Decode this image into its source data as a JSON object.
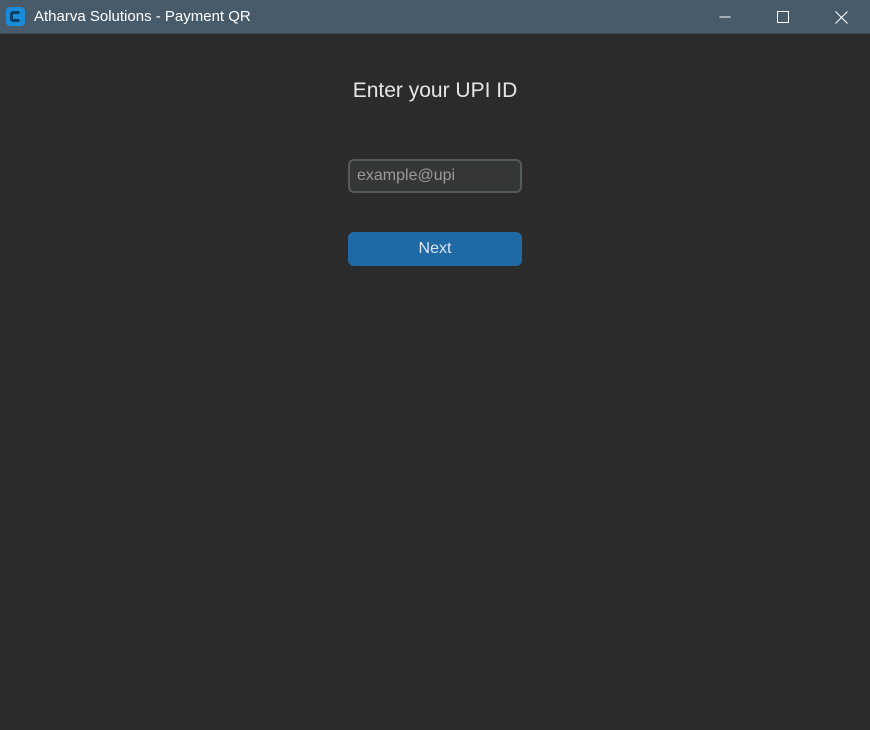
{
  "window": {
    "title": "Atharva Solutions - Payment QR",
    "app_icon": "app-c-logo-icon",
    "controls": {
      "minimize_icon": "minimize-icon",
      "maximize_icon": "maximize-icon",
      "close_icon": "close-icon"
    }
  },
  "main": {
    "heading": "Enter your UPI ID",
    "upi_input": {
      "value": "",
      "placeholder": "example@upi"
    },
    "next_label": "Next"
  },
  "colors": {
    "titlebar": "#475b6b",
    "background": "#2b2b2b",
    "accent": "#1f6aa5",
    "input_bg": "#343638",
    "input_border": "#565b5e"
  }
}
